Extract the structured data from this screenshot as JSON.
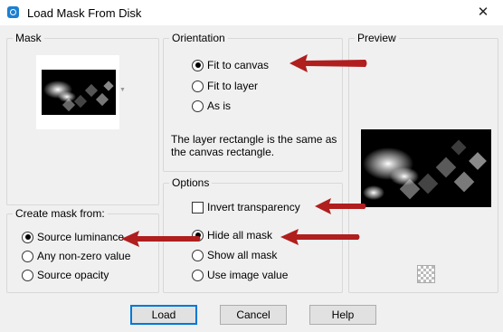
{
  "window": {
    "title": "Load Mask From Disk",
    "close_glyph": "✕"
  },
  "mask": {
    "label": "Mask"
  },
  "orientation": {
    "label": "Orientation",
    "options": [
      "Fit to canvas",
      "Fit to layer",
      "As is"
    ],
    "selected": "Fit to canvas",
    "description": "The layer rectangle is the same as the canvas rectangle."
  },
  "preview": {
    "label": "Preview"
  },
  "create_mask": {
    "label": "Create mask from:",
    "options": [
      "Source luminance",
      "Any non-zero value",
      "Source opacity"
    ],
    "selected": "Source luminance"
  },
  "options": {
    "label": "Options",
    "invert_label": "Invert transparency",
    "invert_checked": false,
    "mask_options": [
      "Hide all mask",
      "Show all mask",
      "Use image value"
    ],
    "selected": "Hide all mask"
  },
  "buttons": {
    "load": "Load",
    "cancel": "Cancel",
    "help": "Help"
  },
  "icons": {
    "app": "paintshop-icon",
    "transparency": "checkerboard-icon"
  },
  "colors": {
    "arrow": "#b01e1e",
    "accent": "#0078d7"
  }
}
